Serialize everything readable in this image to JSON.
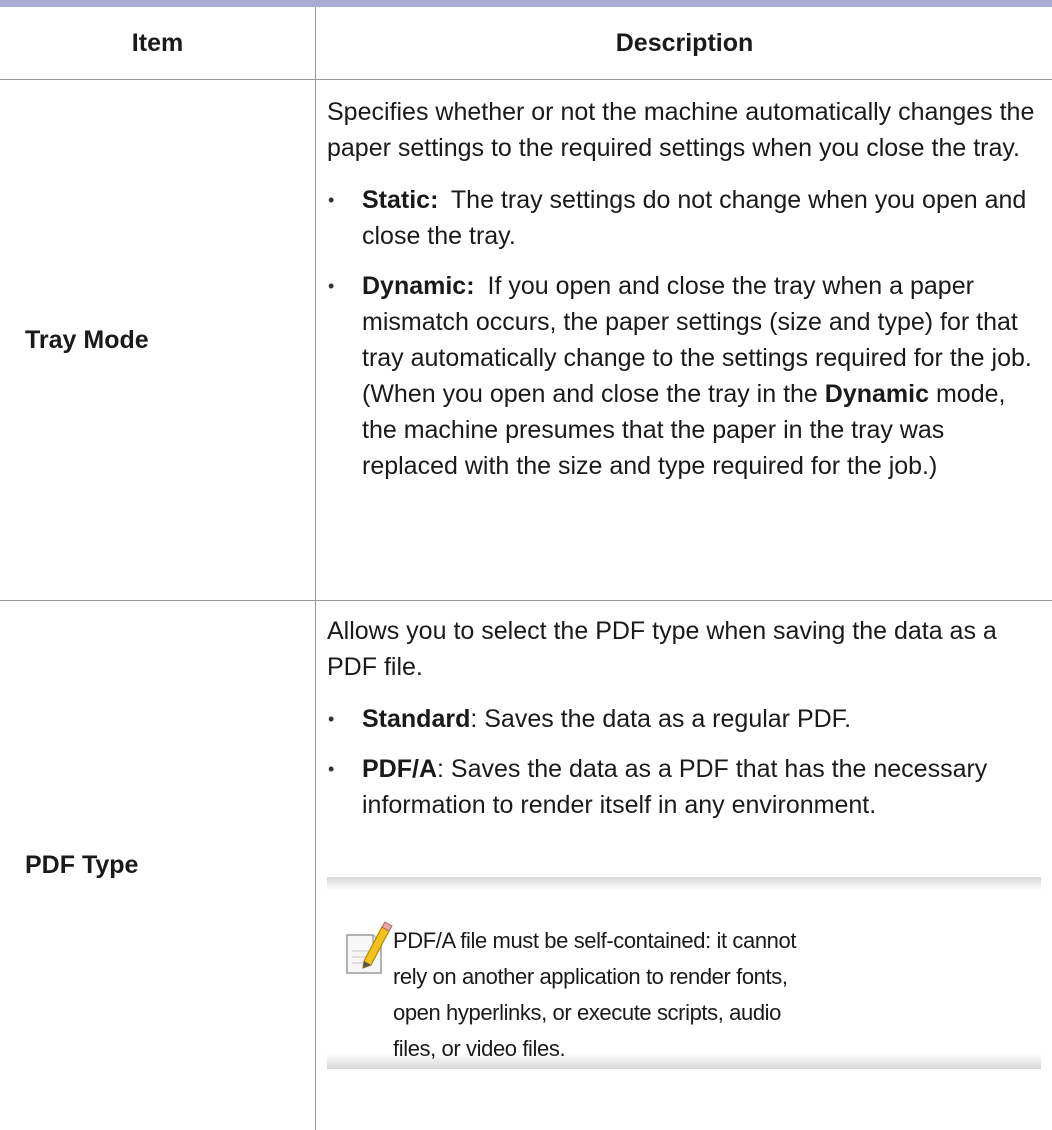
{
  "table": {
    "headers": {
      "item": "Item",
      "description": "Description"
    },
    "rows": [
      {
        "item": "Tray Mode",
        "intro": "Specifies whether or not the machine automatically changes the paper settings to the required settings when you close the tray.",
        "bullets": [
          {
            "term": "Static:",
            "text": "The tray settings do not change when you open and close the tray."
          },
          {
            "term": "Dynamic:",
            "text_before": "If you open and close the tray when a paper mismatch occurs, the paper settings (size and type) for that tray automatically change to the settings required for the job. (When you open and close the tray in the",
            "inline_bold": "Dynamic",
            "text_after": "mode, the machine presumes that the paper in the tray was replaced with the size and type required for the job.)"
          }
        ]
      },
      {
        "item": "PDF Type",
        "intro": "Allows you to select the PDF type when saving the data as a PDF file.",
        "bullets": [
          {
            "term": "Standard",
            "text": ": Saves the data as a regular PDF."
          },
          {
            "term": "PDF/A",
            "text": ": Saves the data as a PDF that has the necessary information to render itself in any environment."
          }
        ],
        "note": {
          "icon": "note-pencil-icon",
          "text": "PDF/A file must be self-contained: it cannot rely on another application to render fonts, open hyperlinks, or execute scripts, audio files, or video files."
        }
      }
    ]
  },
  "colors": {
    "top_rule": "#a9abd4",
    "border": "#9a9a9a",
    "pencil": "#f2c21b"
  }
}
